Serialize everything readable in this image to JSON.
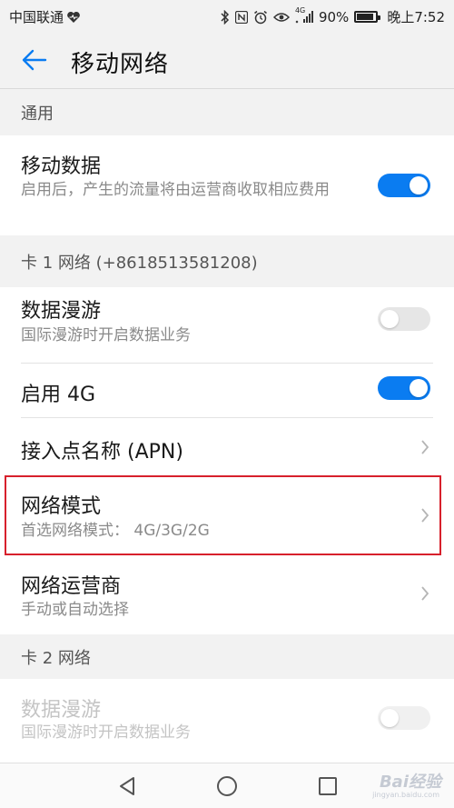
{
  "status_bar": {
    "carrier": "中国联通",
    "network_type": "4G",
    "battery": "90%",
    "battery_level": 0.9,
    "time": "晚上7:52"
  },
  "header": {
    "title": "移动网络"
  },
  "sections": {
    "general": {
      "label": "通用"
    },
    "sim1": {
      "label": "卡 1 网络 (+8618513581208)"
    },
    "sim2": {
      "label": "卡 2 网络"
    }
  },
  "rows": {
    "mobile_data": {
      "title": "移动数据",
      "subtitle": "启用后，产生的流量将由运营商收取相应费用",
      "toggle": "on"
    },
    "data_roaming_1": {
      "title": "数据漫游",
      "subtitle": "国际漫游时开启数据业务",
      "toggle": "off"
    },
    "enable_4g": {
      "title": "启用 4G",
      "toggle": "on"
    },
    "apn": {
      "title": "接入点名称 (APN)"
    },
    "network_mode": {
      "title": "网络模式",
      "subtitle": "首选网络模式： 4G/3G/2G"
    },
    "carrier": {
      "title": "网络运营商",
      "subtitle": "手动或自动选择"
    },
    "data_roaming_2": {
      "title": "数据漫游",
      "subtitle": "国际漫游时开启数据业务",
      "toggle": "off",
      "disabled": true
    }
  },
  "colors": {
    "accent": "#0a7cf1",
    "highlight_border": "#d7202c",
    "background": "#f2f2f2"
  },
  "watermark": {
    "text": "Bai经验",
    "url": "jingyan.baidu.com"
  }
}
